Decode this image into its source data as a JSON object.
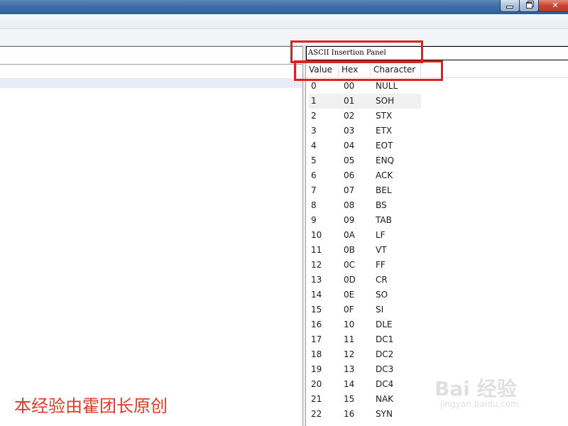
{
  "panel": {
    "title": "ASCII Insertion Panel",
    "columns": [
      "Value",
      "Hex",
      "Character"
    ],
    "rows": [
      {
        "value": "0",
        "hex": "00",
        "character": "NULL"
      },
      {
        "value": "1",
        "hex": "01",
        "character": "SOH"
      },
      {
        "value": "2",
        "hex": "02",
        "character": "STX"
      },
      {
        "value": "3",
        "hex": "03",
        "character": "ETX"
      },
      {
        "value": "4",
        "hex": "04",
        "character": "EOT"
      },
      {
        "value": "5",
        "hex": "05",
        "character": "ENQ"
      },
      {
        "value": "6",
        "hex": "06",
        "character": "ACK"
      },
      {
        "value": "7",
        "hex": "07",
        "character": "BEL"
      },
      {
        "value": "8",
        "hex": "08",
        "character": "BS"
      },
      {
        "value": "9",
        "hex": "09",
        "character": "TAB"
      },
      {
        "value": "10",
        "hex": "0A",
        "character": "LF"
      },
      {
        "value": "11",
        "hex": "0B",
        "character": "VT"
      },
      {
        "value": "12",
        "hex": "0C",
        "character": "FF"
      },
      {
        "value": "13",
        "hex": "0D",
        "character": "CR"
      },
      {
        "value": "14",
        "hex": "0E",
        "character": "SO"
      },
      {
        "value": "15",
        "hex": "0F",
        "character": "SI"
      },
      {
        "value": "16",
        "hex": "10",
        "character": "DLE"
      },
      {
        "value": "17",
        "hex": "11",
        "character": "DC1"
      },
      {
        "value": "18",
        "hex": "12",
        "character": "DC2"
      },
      {
        "value": "19",
        "hex": "13",
        "character": "DC3"
      },
      {
        "value": "20",
        "hex": "14",
        "character": "DC4"
      },
      {
        "value": "21",
        "hex": "15",
        "character": "NAK"
      },
      {
        "value": "22",
        "hex": "16",
        "character": "SYN"
      }
    ],
    "selected_row_index": 1
  },
  "window_controls": {
    "icons": [
      "minimize-icon",
      "restore-icon",
      "close-icon"
    ]
  },
  "watermark": {
    "caption": "本经验由霍团长原创",
    "logo_text": "Bai 经验",
    "url": "jingyan.baidu.com"
  },
  "colors": {
    "annotation_red": "#e0201b",
    "titlebar_blue": "#3f6ea6",
    "caption_red": "#e23b2a",
    "selected_row": "#f0f0f0"
  }
}
